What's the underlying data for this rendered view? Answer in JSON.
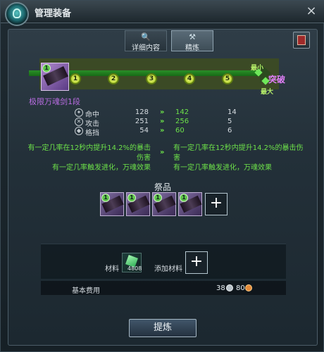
{
  "window": {
    "title": "管理装备",
    "close_glyph": "×"
  },
  "tabs": [
    {
      "label": "详细内容",
      "icon": "search-icon",
      "glyph": "🔍",
      "active": false
    },
    {
      "label": "精炼",
      "icon": "anvil-icon",
      "glyph": "⚒",
      "active": true
    }
  ],
  "progress": {
    "weapon_level_badge": "1",
    "nodes": [
      "1",
      "2",
      "3",
      "4",
      "5"
    ],
    "min_label": "最小",
    "max_label": "最大",
    "breakthrough_label": "突破",
    "weapon_name": "极限万魂剑1段"
  },
  "stats": [
    {
      "icon": "crosshair-icon",
      "glyph": "✦",
      "label": "命中",
      "current": "128",
      "arrow": "»",
      "new": "142",
      "delta": "14"
    },
    {
      "icon": "swords-icon",
      "glyph": "✕",
      "label": "攻击",
      "current": "251",
      "arrow": "»",
      "new": "256",
      "delta": "5"
    },
    {
      "icon": "shield-icon",
      "glyph": "◆",
      "label": "格挡",
      "current": "54",
      "arrow": "»",
      "new": "60",
      "delta": "6"
    }
  ],
  "effects": {
    "left_line1": "有一定几率在12秒内提升14.2%的暴击伤害",
    "left_line2": "有一定几率触发进化，万魂效果",
    "arrow": "»",
    "right_line1": "有一定几率在12秒内提升14.2%的暴击伤害",
    "right_line2": "有一定几率触发进化，万魂效果"
  },
  "sacrifice": {
    "title": "祭品",
    "slots": [
      "1",
      "1",
      "1",
      "1"
    ],
    "add_glyph": "+"
  },
  "materials": {
    "label": "材料",
    "count": "4808",
    "add_label": "添加材料",
    "add_glyph": "+"
  },
  "cost": {
    "label": "基本费用",
    "silver": "38",
    "bronze": "80"
  },
  "action": {
    "refine_label": "提炼"
  }
}
